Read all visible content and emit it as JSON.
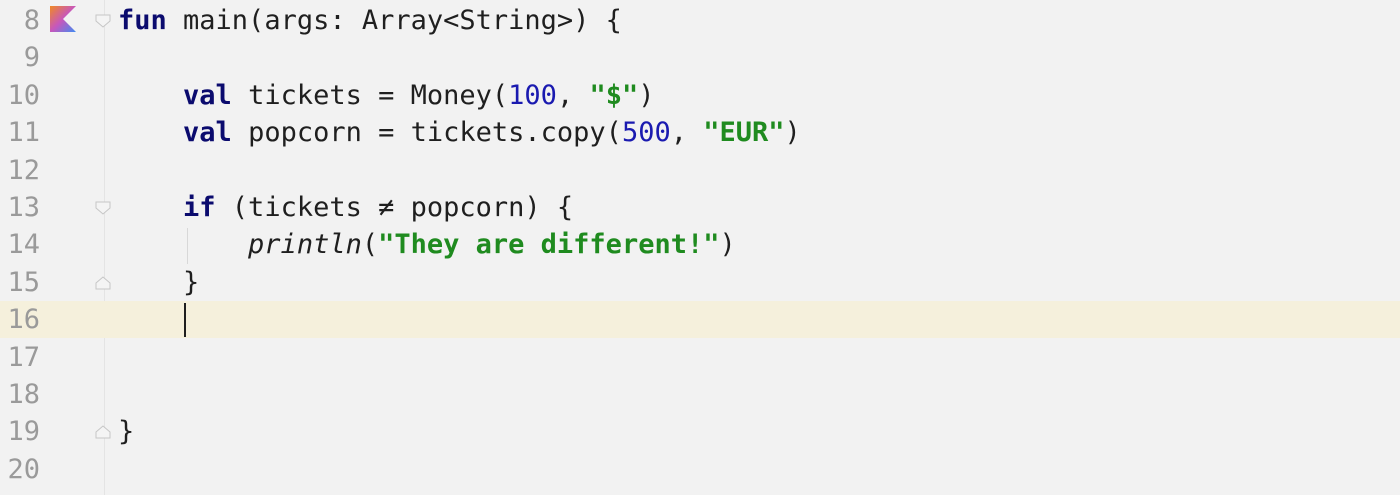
{
  "editor": {
    "current_line": 16,
    "lines": [
      {
        "num": "8",
        "tokens": [
          {
            "t": "fun",
            "c": "kw"
          },
          {
            "t": " main(args: Array<String>) {",
            "c": ""
          }
        ]
      },
      {
        "num": "9",
        "tokens": []
      },
      {
        "num": "10",
        "tokens": [
          {
            "t": "    ",
            "c": ""
          },
          {
            "t": "val",
            "c": "kw"
          },
          {
            "t": " tickets = Money(",
            "c": ""
          },
          {
            "t": "100",
            "c": "num"
          },
          {
            "t": ", ",
            "c": ""
          },
          {
            "t": "\"$\"",
            "c": "str"
          },
          {
            "t": ")",
            "c": ""
          }
        ]
      },
      {
        "num": "11",
        "tokens": [
          {
            "t": "    ",
            "c": ""
          },
          {
            "t": "val",
            "c": "kw"
          },
          {
            "t": " popcorn = tickets.copy(",
            "c": ""
          },
          {
            "t": "500",
            "c": "num"
          },
          {
            "t": ", ",
            "c": ""
          },
          {
            "t": "\"EUR\"",
            "c": "str"
          },
          {
            "t": ")",
            "c": ""
          }
        ]
      },
      {
        "num": "12",
        "tokens": []
      },
      {
        "num": "13",
        "tokens": [
          {
            "t": "    ",
            "c": ""
          },
          {
            "t": "if",
            "c": "kw"
          },
          {
            "t": " (tickets ≠ popcorn) {",
            "c": ""
          }
        ]
      },
      {
        "num": "14",
        "tokens": [
          {
            "t": "        ",
            "c": ""
          },
          {
            "t": "println",
            "c": "fn-italic"
          },
          {
            "t": "(",
            "c": ""
          },
          {
            "t": "\"They are different!\"",
            "c": "str"
          },
          {
            "t": ")",
            "c": ""
          }
        ]
      },
      {
        "num": "15",
        "tokens": [
          {
            "t": "    }",
            "c": ""
          }
        ]
      },
      {
        "num": "16",
        "tokens": []
      },
      {
        "num": "17",
        "tokens": []
      },
      {
        "num": "18",
        "tokens": []
      },
      {
        "num": "19",
        "tokens": [
          {
            "t": "}",
            "c": ""
          }
        ]
      },
      {
        "num": "20",
        "tokens": []
      }
    ],
    "fold_markers": [
      {
        "line": "8",
        "kind": "open"
      },
      {
        "line": "13",
        "kind": "open"
      },
      {
        "line": "15",
        "kind": "close"
      },
      {
        "line": "19",
        "kind": "close"
      }
    ],
    "run_icon": "kotlin-run-icon",
    "colors": {
      "background": "#f2f2f2",
      "current_line": "#f5f0dc",
      "keyword": "#0b0b6e",
      "number": "#1a1ab0",
      "string": "#1f8b1f",
      "line_number": "#9a9a9a"
    }
  }
}
